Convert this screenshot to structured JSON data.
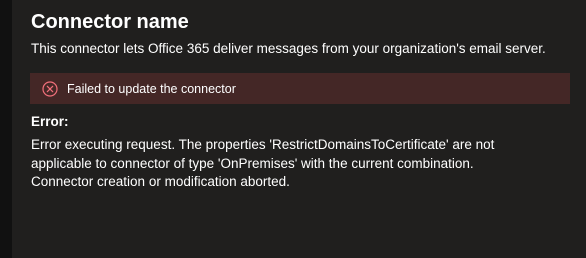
{
  "panel": {
    "title": "Connector name",
    "description": "This connector lets Office 365 deliver messages from your organization's email server."
  },
  "banner": {
    "icon": "error-circle-x-icon",
    "text": "Failed to update the connector",
    "background_color": "#442726",
    "icon_color": "#f1707b"
  },
  "error": {
    "heading": "Error:",
    "message": "Error executing request. The properties 'RestrictDomainsToCertificate' are not applicable to connector of type 'OnPremises' with the current combination. Connector creation or modification aborted."
  }
}
